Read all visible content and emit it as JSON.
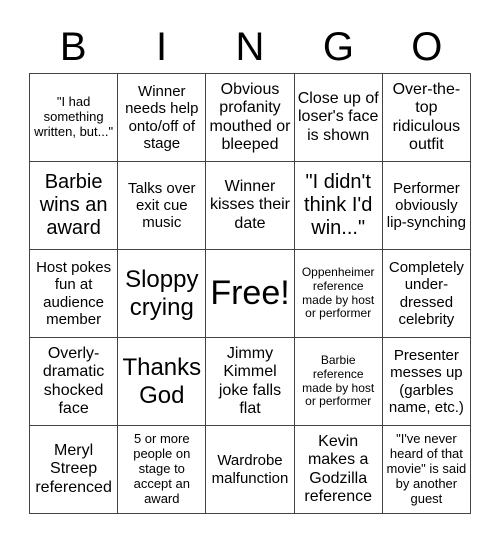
{
  "header": [
    "B",
    "I",
    "N",
    "G",
    "O"
  ],
  "cells": [
    "\"I had something written, but...\"",
    "Winner needs help onto/off of stage",
    "Obvious profanity mouthed or bleeped",
    "Close up of loser's face is shown",
    "Over-the-top ridiculous outfit",
    "Barbie wins an award",
    "Talks over exit cue music",
    "Winner kisses their date",
    "\"I didn't think I'd win...\"",
    "Performer obviously lip-synching",
    "Host pokes fun at audience member",
    "Sloppy crying",
    "Free!",
    "Oppenheimer reference made by host or performer",
    "Completely under-dressed celebrity",
    "Overly-dramatic shocked face",
    "Thanks God",
    "Jimmy Kimmel joke falls flat",
    "Barbie reference made by host or performer",
    "Presenter messes up (garbles name, etc.)",
    "Meryl Streep referenced",
    "5 or more people on stage to accept an award",
    "Wardrobe malfunction",
    "Kevin makes a Godzilla reference",
    "\"I've never heard of that movie\" is said by another guest"
  ]
}
